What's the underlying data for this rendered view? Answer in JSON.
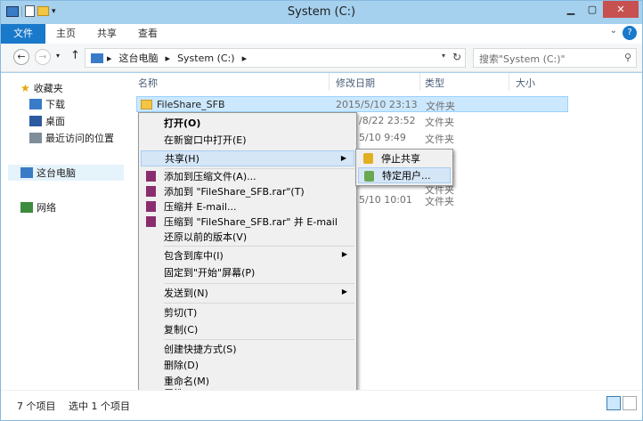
{
  "window": {
    "title": "System (C:)"
  },
  "ribbon": {
    "tabs": [
      "文件",
      "主页",
      "共享",
      "查看"
    ]
  },
  "address": {
    "segments": [
      "这台电脑",
      "System (C:)"
    ],
    "search_placeholder": "搜索\"System (C:)\""
  },
  "nav_pane": {
    "favorites": "收藏夹",
    "downloads": "下载",
    "desktop": "桌面",
    "recent": "最近访问的位置",
    "this_pc": "这台电脑",
    "network": "网络"
  },
  "columns": {
    "name": "名称",
    "date": "修改日期",
    "type": "类型",
    "size": "大小"
  },
  "files": [
    {
      "name": "FileShare_SFB",
      "date": "2015/5/10 23:13",
      "type": "文件夹"
    },
    {
      "name": "",
      "date": "/8/22 23:52",
      "type": "文件夹"
    },
    {
      "name": "",
      "date": "5/10 9:49",
      "type": "文件夹"
    },
    {
      "name": "",
      "date": "",
      "type": "文件夹"
    },
    {
      "name": "",
      "date": "",
      "type": "文件夹"
    },
    {
      "name": "",
      "date": "",
      "type": "文件夹"
    },
    {
      "name": "",
      "date": "5/10 10:01",
      "type": "文件夹"
    }
  ],
  "context_menu": {
    "open": "打开(O)",
    "open_new": "在新窗口中打开(E)",
    "share": "共享(H)",
    "add_archive": "添加到压缩文件(A)...",
    "add_rar": "添加到 \"FileShare_SFB.rar\"(T)",
    "compress_email": "压缩并 E-mail...",
    "compress_rar_email": "压缩到 \"FileShare_SFB.rar\" 并 E-mail",
    "restore": "还原以前的版本(V)",
    "include_library": "包含到库中(I)",
    "pin_start": "固定到\"开始\"屏幕(P)",
    "send_to": "发送到(N)",
    "cut": "剪切(T)",
    "copy": "复制(C)",
    "create_shortcut": "创建快捷方式(S)",
    "delete": "删除(D)",
    "rename": "重命名(M)",
    "properties": "属性(R)"
  },
  "share_submenu": {
    "stop_sharing": "停止共享",
    "specific_people": "特定用户..."
  },
  "status": {
    "items": "7 个项目",
    "selected": "选中 1 个项目"
  }
}
